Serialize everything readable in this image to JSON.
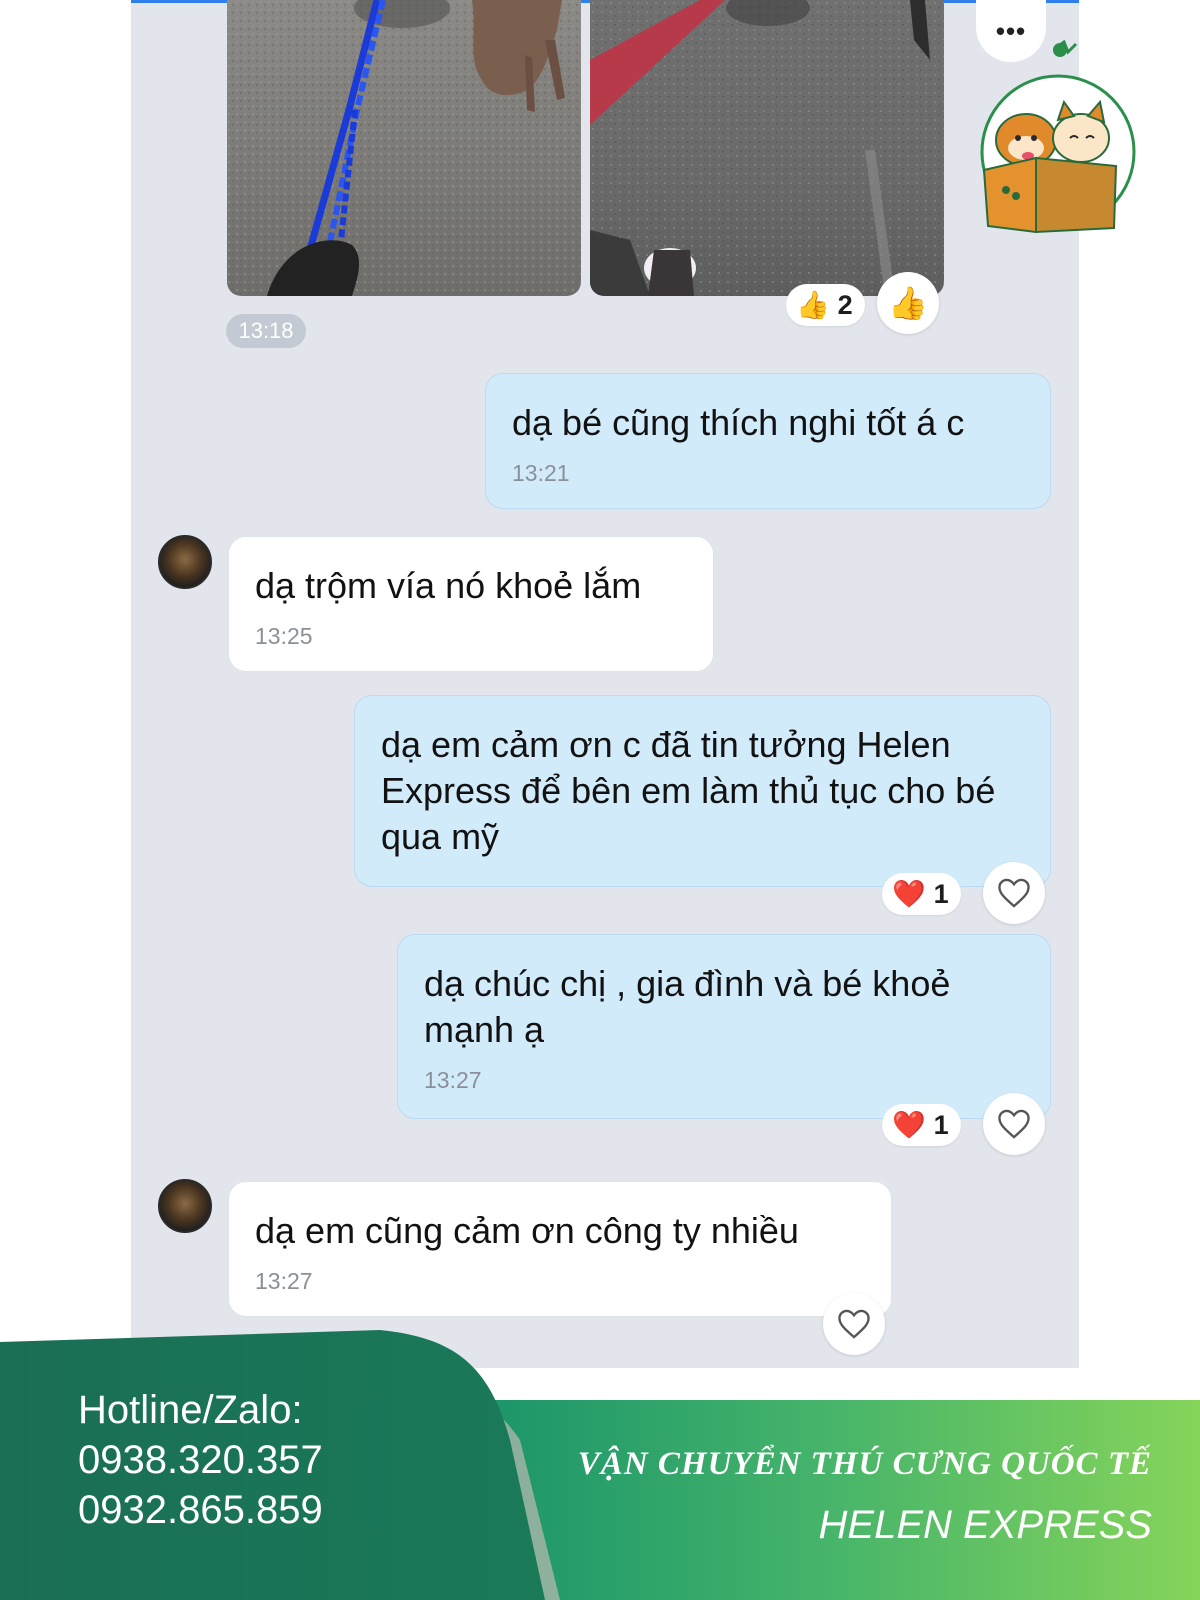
{
  "chat": {
    "image_time": "13:18",
    "image_reaction": {
      "emoji": "👍",
      "count": "2"
    },
    "messages": [
      {
        "side": "out",
        "text": "dạ bé cũng thích nghi tốt á c",
        "time": "13:21"
      },
      {
        "side": "in",
        "text": "dạ trộm vía nó khoẻ lắm",
        "time": "13:25"
      },
      {
        "side": "out",
        "text": "dạ em cảm ơn c đã tin tưởng Helen Express để bên em làm thủ tục cho bé qua mỹ",
        "reaction": {
          "emoji": "❤️",
          "count": "1"
        }
      },
      {
        "side": "out",
        "text": "dạ chúc chị , gia đình và bé khoẻ mạnh ạ",
        "time": "13:27",
        "reaction": {
          "emoji": "❤️",
          "count": "1"
        }
      },
      {
        "side": "in",
        "text": "dạ em cũng cảm ơn công ty nhiều",
        "time": "13:27"
      }
    ]
  },
  "icons": {
    "more": "more-dots-icon",
    "like": "thumbs-up-icon",
    "heart_outline": "heart-outline-icon",
    "heart_filled": "heart-filled-icon"
  },
  "brand": {
    "logo_text": "HelenExpress"
  },
  "footer": {
    "hotline_label": "Hotline/Zalo:",
    "phone_1": "0938.320.357",
    "phone_2": "0932.865.859",
    "slogan_line_1": "VẬN CHUYỂN THÚ CƯNG QUỐC TẾ",
    "slogan_line_2": "HELEN EXPRESS"
  },
  "colors": {
    "chat_background": "#e2e6ec",
    "outgoing_bubble": "#d2ebfb",
    "incoming_bubble": "#ffffff",
    "footer_dark_green": "#1a7356",
    "footer_light_green": "#7ed05a",
    "heart_red": "#e8232f"
  }
}
